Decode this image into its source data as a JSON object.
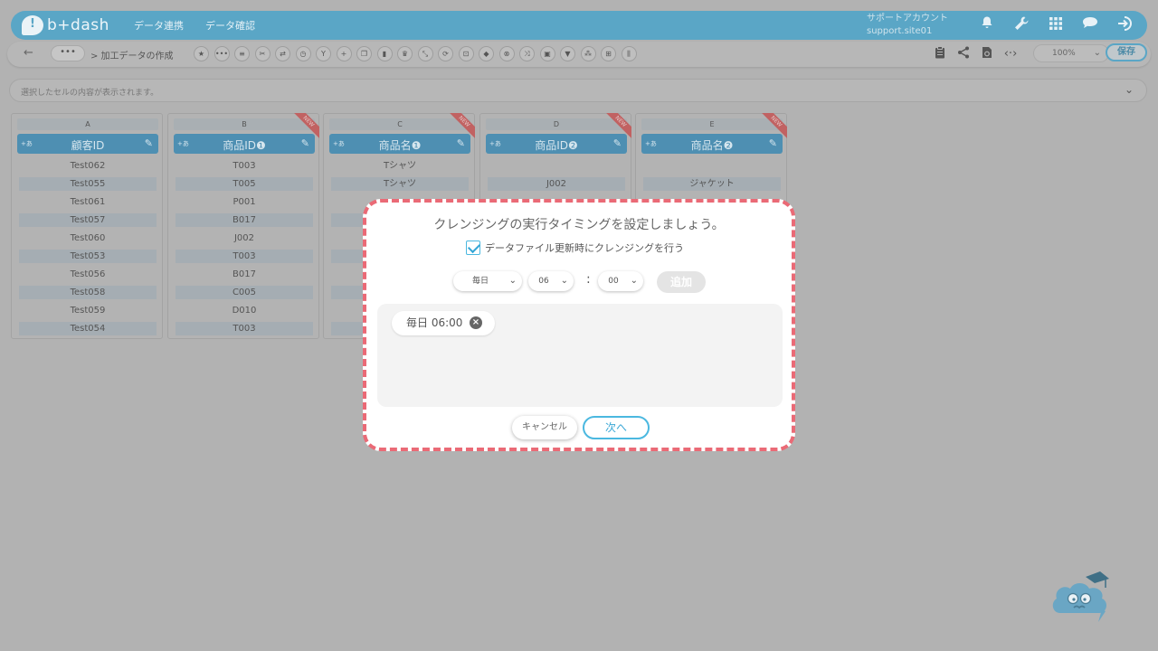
{
  "header": {
    "logo_text": "b+dash",
    "nav": [
      "データ連携",
      "データ確認"
    ],
    "account_line1": "サポートアカウント",
    "account_line2": "support.site01",
    "icons": [
      "bell-icon",
      "wrench-icon",
      "grid-icon",
      "chat-icon",
      "logout-icon"
    ]
  },
  "toolbar": {
    "back": "←",
    "more": "•••",
    "breadcrumb": "> 加工データの作成",
    "zoom": "100%",
    "save_label": "保存"
  },
  "cellbar": {
    "placeholder": "選択したセルの内容が表示されます。"
  },
  "columns": [
    {
      "letter": "A",
      "type": "+あ",
      "name": "顧客ID",
      "new": false,
      "cells": [
        "Test062",
        "Test055",
        "Test061",
        "Test057",
        "Test060",
        "Test053",
        "Test056",
        "Test058",
        "Test059",
        "Test054"
      ]
    },
    {
      "letter": "B",
      "type": "+あ",
      "name": "商品ID❶",
      "new": true,
      "new_label": "NEW",
      "cells": [
        "T003",
        "T005",
        "P001",
        "B017",
        "J002",
        "T003",
        "B017",
        "C005",
        "D010",
        "T003"
      ]
    },
    {
      "letter": "C",
      "type": "+あ",
      "name": "商品名❶",
      "new": true,
      "new_label": "NEW",
      "cells": [
        "Tシャツ",
        "Tシャツ",
        "",
        "",
        "",
        "",
        "",
        "",
        "",
        ""
      ]
    },
    {
      "letter": "D",
      "type": "+あ",
      "name": "商品ID❷",
      "new": true,
      "new_label": "NEW",
      "cells": [
        "",
        "J002"
      ]
    },
    {
      "letter": "E",
      "type": "+あ",
      "name": "商品名❷",
      "new": true,
      "new_label": "NEW",
      "cells": [
        "",
        "ジャケット"
      ]
    }
  ],
  "modal": {
    "title": "クレンジングの実行タイミングを設定しましょう。",
    "checkbox_label": "データファイル更新時にクレンジングを行う",
    "checkbox_checked": true,
    "frequency": "毎日",
    "hour": "06",
    "minute": "00",
    "colon": ":",
    "add_label": "追加",
    "schedules": [
      "毎日 06:00"
    ],
    "cancel_label": "キャンセル",
    "next_label": "次へ",
    "accent_color": "#4bb8e0",
    "border_color": "#ea6a76"
  }
}
